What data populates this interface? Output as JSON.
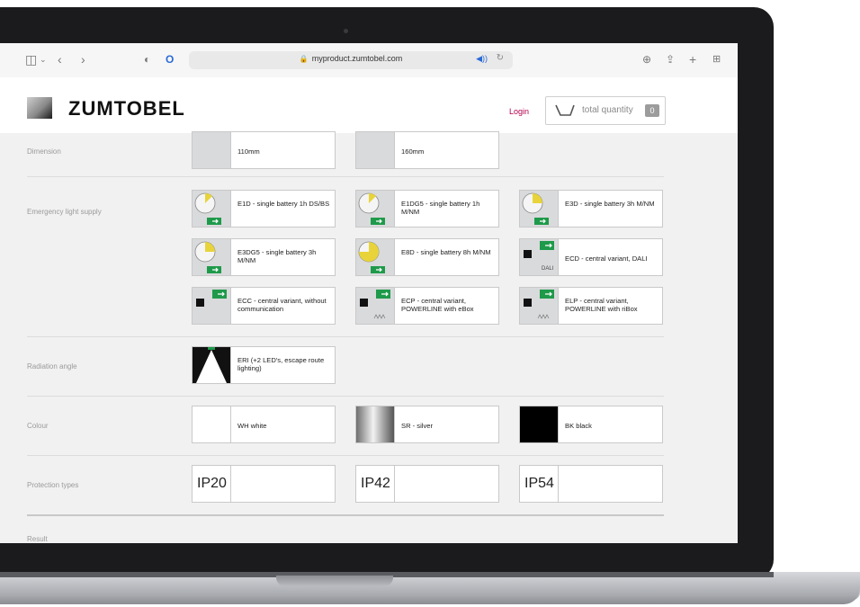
{
  "browser": {
    "url": "myproduct.zumtobel.com",
    "icons": [
      "sidebar-icon",
      "chevron-down-icon",
      "back-icon",
      "forward-icon",
      "shield-icon",
      "extension-icon",
      "lock-icon",
      "audio-icon",
      "reload-icon",
      "download-icon",
      "share-icon",
      "new-tab-icon",
      "tabs-overview-icon"
    ]
  },
  "header": {
    "brand": "ZUMTOBEL",
    "login": "Login",
    "quantity_label": "total quantity",
    "quantity_count": "0"
  },
  "sections": {
    "dimension": {
      "label": "Dimension",
      "options": [
        "110mm",
        "160mm"
      ]
    },
    "emergency": {
      "label": "Emergency light supply",
      "options": [
        "E1D - single battery 1h DS/BS",
        "E1DG5 - single battery 1h M/NM",
        "E3D - single battery 3h M/NM",
        "E3DG5 - single battery 3h M/NM",
        "E8D - single battery 8h M/NM",
        "ECD - central variant, DALI",
        "ECC - central variant, without communication",
        "ECP - central variant, POWERLINE with eBox",
        "ELP - central variant, POWERLINE with riBox"
      ],
      "thumb_badges": [
        "DALI"
      ]
    },
    "radiation": {
      "label": "Radiation angle",
      "options": [
        "ERI (+2 LED's, escape route lighting)"
      ]
    },
    "colour": {
      "label": "Colour",
      "options": [
        "WH white",
        "SR - silver",
        "BK black"
      ]
    },
    "protection": {
      "label": "Protection types",
      "options": [
        "IP20",
        "IP42",
        "IP54"
      ]
    },
    "result": {
      "label": "Result"
    }
  },
  "colors": {
    "brand_accent": "#b4004e",
    "battery_yellow": "#e8d43a",
    "exit_green": "#1e9a4a"
  }
}
